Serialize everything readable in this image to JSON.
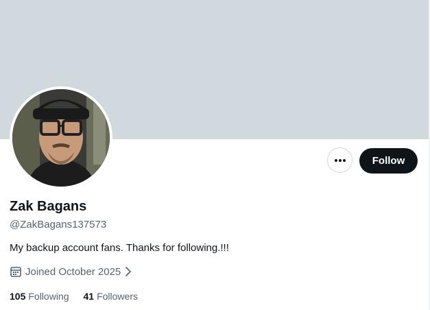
{
  "profile": {
    "display_name": "Zak Bagans",
    "handle": "@ZakBagans137573",
    "bio": "My backup account fans. Thanks for following.!!!",
    "joined": "Joined October 2025",
    "following_count": "105",
    "following_label": "Following",
    "followers_count": "41",
    "followers_label": "Followers"
  },
  "actions": {
    "follow_label": "Follow",
    "more_icon": "more-horizontal-icon"
  },
  "icons": {
    "joined": "calendar-icon",
    "joined_chevron": "chevron-right-icon"
  },
  "colors": {
    "banner": "#cfd9de",
    "follow_button_bg": "#0f1419",
    "secondary_text": "#536471"
  }
}
